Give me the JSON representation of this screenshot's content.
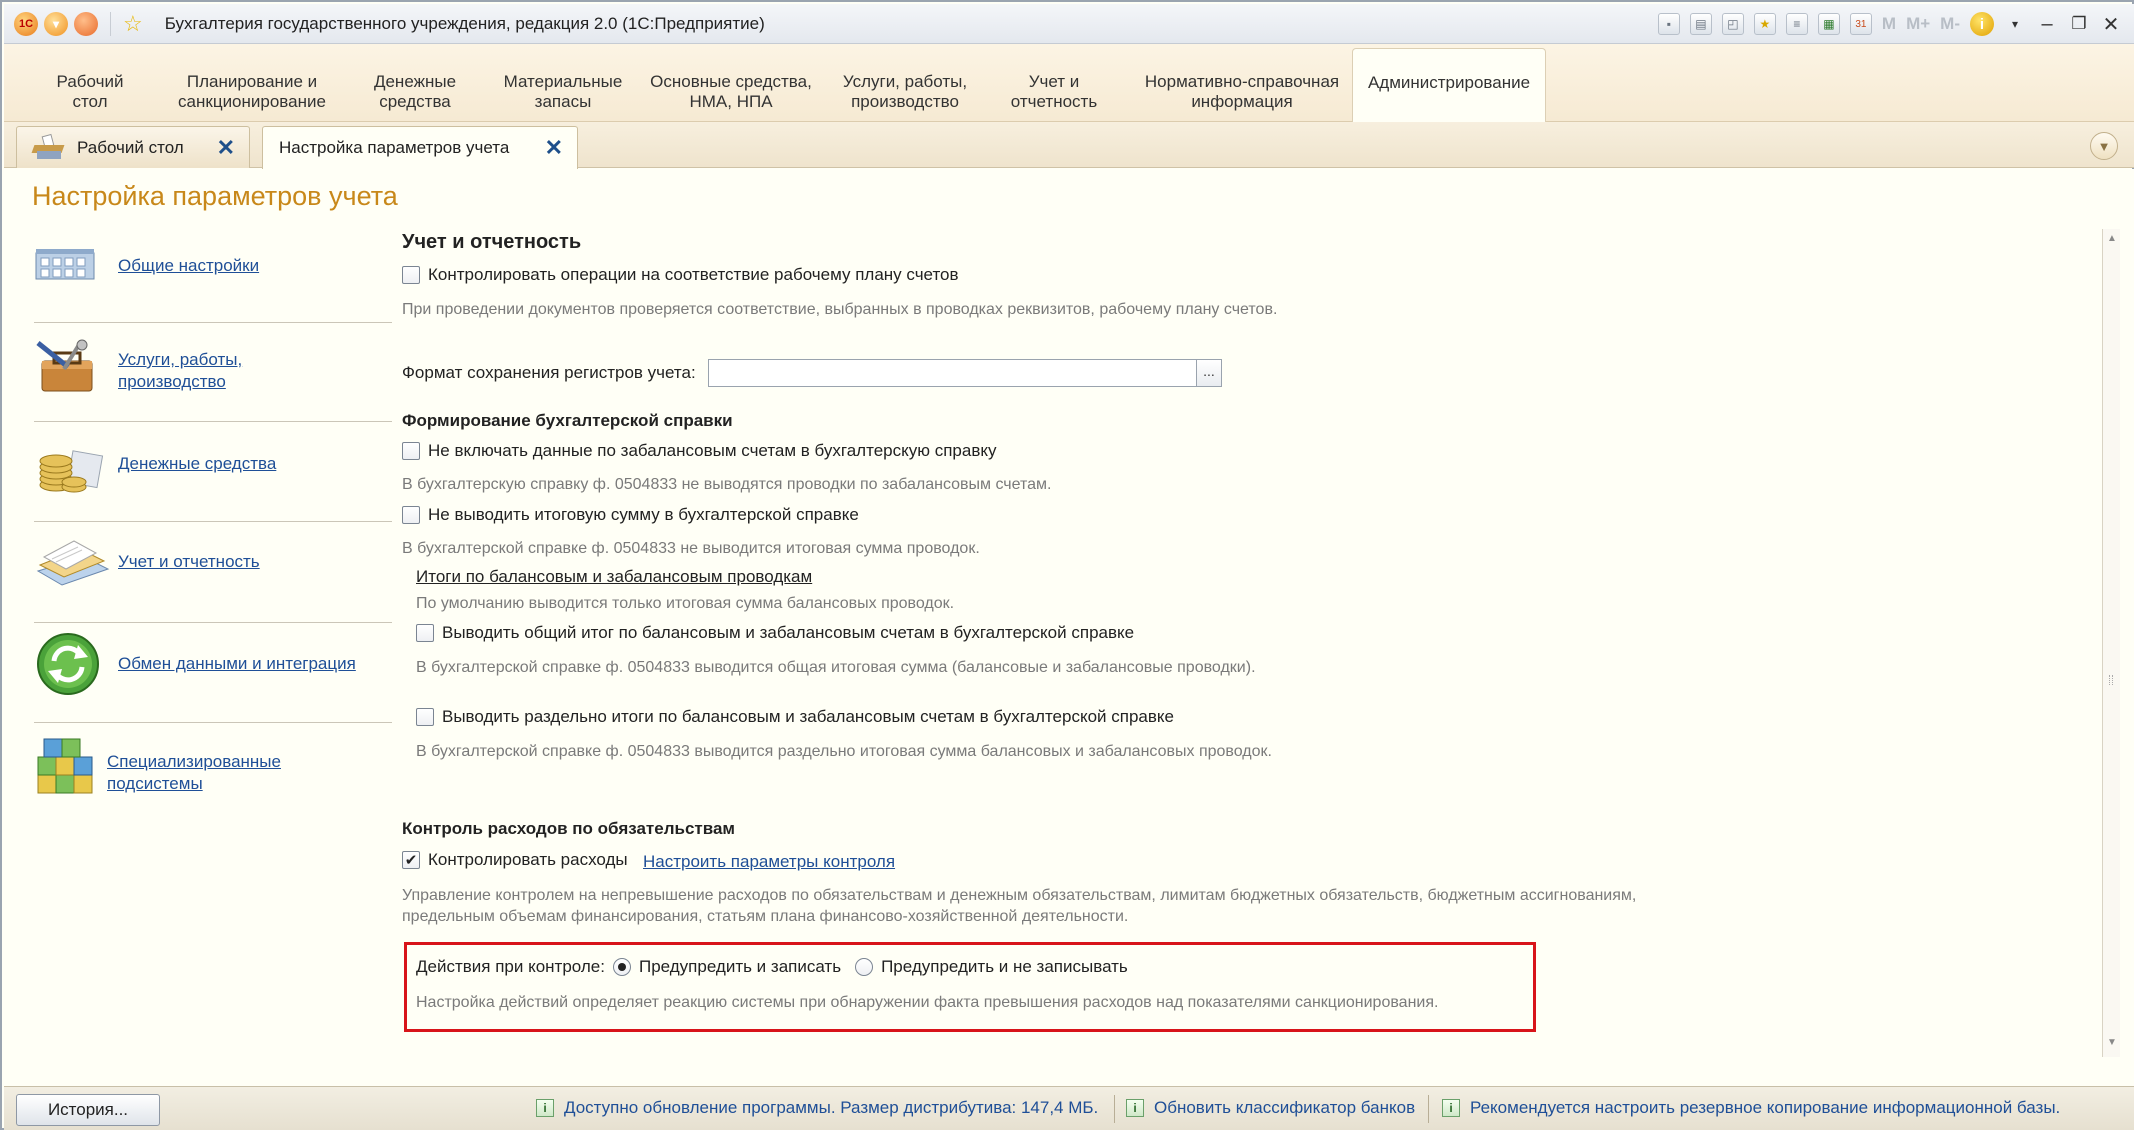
{
  "window": {
    "title": "Бухгалтерия государственного учреждения, редакция 2.0  (1С:Предприятие)",
    "toolbar_letters": [
      "M",
      "M+",
      "M-"
    ]
  },
  "sections": [
    {
      "id": "desktop",
      "line1": "Рабочий",
      "line2": "стол"
    },
    {
      "id": "planning",
      "line1": "Планирование и",
      "line2": "санкционирование"
    },
    {
      "id": "money",
      "line1": "Денежные",
      "line2": "средства"
    },
    {
      "id": "materials",
      "line1": "Материальные",
      "line2": "запасы"
    },
    {
      "id": "fixed-assets",
      "line1": "Основные средства,",
      "line2": "НМА, НПА"
    },
    {
      "id": "services",
      "line1": "Услуги, работы,",
      "line2": "производство"
    },
    {
      "id": "accounting",
      "line1": "Учет и",
      "line2": "отчетность"
    },
    {
      "id": "reference",
      "line1": "Нормативно-справочная",
      "line2": "информация"
    },
    {
      "id": "admin",
      "line1": "Администрирование",
      "line2": ""
    }
  ],
  "tabs": [
    {
      "label": "Рабочий стол"
    },
    {
      "label": "Настройка параметров учета"
    }
  ],
  "form": {
    "title": "Настройка параметров учета",
    "nav": [
      {
        "label": "Общие настройки",
        "icon": "building-icon"
      },
      {
        "label1": "Услуги, работы,",
        "label2": "производство",
        "icon": "toolbox-icon"
      },
      {
        "label": "Денежные средства",
        "icon": "coins-icon"
      },
      {
        "label": "Учет и отчетность",
        "icon": "ledger-icon"
      },
      {
        "label": "Обмен данными и интеграция",
        "icon": "sync-icon"
      },
      {
        "label1": "Специализированные",
        "label2": "подсистемы",
        "icon": "cubes-icon"
      }
    ],
    "accounting": {
      "heading": "Учет и отчетность",
      "control_plan_label": "Контролировать операции на соответствие рабочему плану счетов",
      "control_plan_checked": false,
      "control_plan_hint": "При проведении документов проверяется соответствие, выбранных в проводках реквизитов, рабочему плану счетов.",
      "format_label": "Формат сохранения регистров учета:",
      "format_value": "",
      "format_button": "..."
    },
    "certificate": {
      "heading": "Формирование бухгалтерской справки",
      "offbalance_label": "Не включать данные по забалансовым счетам в бухгалтерскую справку",
      "offbalance_checked": false,
      "offbalance_hint": "В бухгалтерскую справку ф. 0504833 не выводятся проводки по забалансовым счетам.",
      "no_total_label": "Не выводить итоговую сумму в бухгалтерской справке",
      "no_total_checked": false,
      "no_total_hint": "В бухгалтерской справке ф. 0504833 не выводится итоговая сумма проводок.",
      "totals_title": "Итоги по балансовым и забалансовым проводкам",
      "totals_hint": "По умолчанию выводится только итоговая сумма балансовых проводок.",
      "common_total_label": "Выводить общий итог по балансовым и забалансовым счетам в бухгалтерской справке",
      "common_total_checked": false,
      "common_total_hint": "В бухгалтерской справке ф. 0504833 выводится общая итоговая сумма (балансовые и забалансовые проводки).",
      "separate_total_label": "Выводить раздельно итоги по балансовым и забалансовым счетам в бухгалтерской справке",
      "separate_total_checked": false,
      "separate_total_hint": "В бухгалтерской справке ф. 0504833 выводится раздельно итоговая сумма балансовых и забалансовых проводок."
    },
    "expense_control": {
      "heading": "Контроль расходов по обязательствам",
      "control_label": "Контролировать расходы",
      "control_checked": true,
      "control_link": "Настроить параметры контроля",
      "hint_line1": "Управление контролем на непревышение расходов по обязательствам и денежным обязательствам, лимитам бюджетных обязательств, бюджетным ассигнованиям,",
      "hint_line2": "предельным объемам финансирования, статьям плана финансово-хозяйственной деятельности.",
      "actions_label": "Действия при контроле:",
      "option1": "Предупредить и записать",
      "option2": "Предупредить и не записывать",
      "selected_option": "Предупредить и записать",
      "actions_hint": "Настройка действий определяет реакцию системы при обнаружении факта превышения расходов над показателями санкционирования.",
      "highlight_color": "#d8141a"
    }
  },
  "statusbar": {
    "history_button": "История...",
    "messages": [
      "Доступно обновление программы. Размер дистрибутива: 147,4 МБ.",
      "Обновить классификатор банков",
      "Рекомендуется настроить резервное копирование информационной базы."
    ]
  }
}
